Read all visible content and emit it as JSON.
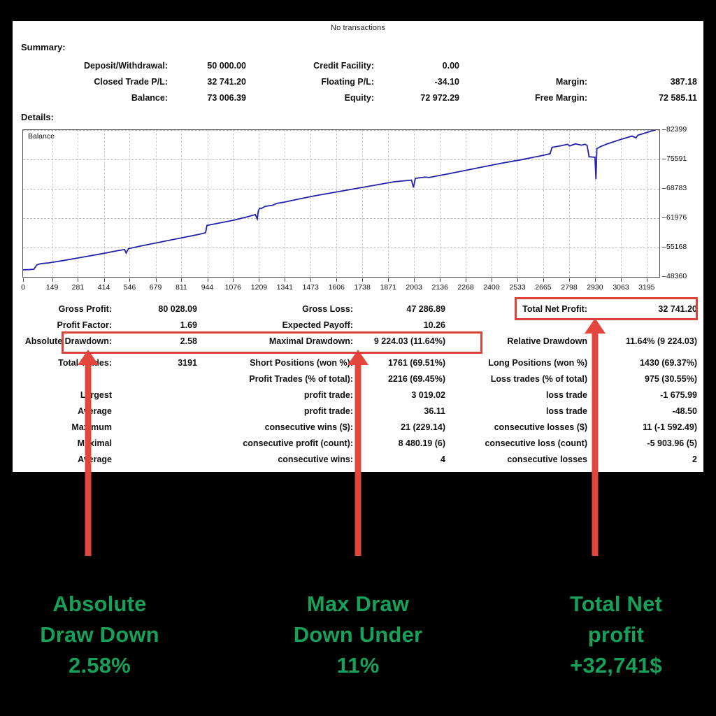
{
  "report": {
    "no_transactions": "No transactions",
    "summary_label": "Summary:",
    "details_label": "Details:",
    "summary_rows": [
      {
        "c1_label": "Deposit/Withdrawal:",
        "c1_value": "50 000.00",
        "c2_label": "Credit Facility:",
        "c2_value": "0.00",
        "c3_label": "",
        "c3_value": ""
      },
      {
        "c1_label": "Closed Trade P/L:",
        "c1_value": "32 741.20",
        "c2_label": "Floating P/L:",
        "c2_value": "-34.10",
        "c3_label": "Margin:",
        "c3_value": "387.18"
      },
      {
        "c1_label": "Balance:",
        "c1_value": "73 006.39",
        "c2_label": "Equity:",
        "c2_value": "72 972.29",
        "c3_label": "Free Margin:",
        "c3_value": "72 585.11"
      }
    ],
    "details_rows": [
      {
        "c1_label": "Gross Profit:",
        "c1_value": "80 028.09",
        "c2_label": "Gross Loss:",
        "c2_value": "47 286.89",
        "c3_label": "Total Net Profit:",
        "c3_value": "32 741.20"
      },
      {
        "c1_label": "Profit Factor:",
        "c1_value": "1.69",
        "c2_label": "Expected Payoff:",
        "c2_value": "10.26",
        "c3_label": "",
        "c3_value": ""
      },
      {
        "c1_label": "Absolute Drawdown:",
        "c1_value": "2.58",
        "c2_label": "Maximal Drawdown:",
        "c2_value": "9 224.03 (11.64%)",
        "c3_label": "Relative Drawdown",
        "c3_value": "11.64% (9 224.03)"
      },
      {
        "c1_label": "Total Trades:",
        "c1_value": "3191",
        "c2_label": "Short Positions (won %):",
        "c2_value": "1761 (69.51%)",
        "c3_label": "Long Positions (won %)",
        "c3_value": "1430 (69.37%)"
      },
      {
        "c1_label": "",
        "c1_value": "",
        "c2_label": "Profit Trades (% of total):",
        "c2_value": "2216 (69.45%)",
        "c3_label": "Loss trades (% of total)",
        "c3_value": "975 (30.55%)"
      },
      {
        "c1_label": "Largest",
        "c1_value": "",
        "c2_label": "profit trade:",
        "c2_value": "3 019.02",
        "c3_label": "loss trade",
        "c3_value": "-1 675.99"
      },
      {
        "c1_label": "Average",
        "c1_value": "",
        "c2_label": "profit trade:",
        "c2_value": "36.11",
        "c3_label": "loss trade",
        "c3_value": "-48.50"
      },
      {
        "c1_label": "Maximum",
        "c1_value": "",
        "c2_label": "consecutive wins ($):",
        "c2_value": "21 (229.14)",
        "c3_label": "consecutive losses ($)",
        "c3_value": "11 (-1 592.49)"
      },
      {
        "c1_label": "Maximal",
        "c1_value": "",
        "c2_label": "consecutive profit (count):",
        "c2_value": "8 480.19 (6)",
        "c3_label": "consecutive loss (count)",
        "c3_value": "-5 903.96 (5)"
      },
      {
        "c1_label": "Average",
        "c1_value": "",
        "c2_label": "consecutive wins:",
        "c2_value": "4",
        "c3_label": "consecutive losses",
        "c3_value": "2"
      }
    ]
  },
  "annotations": {
    "highlight_color": "#d9443a",
    "arrow_color": "#e2463c",
    "caption_color": "#17a05a",
    "items": [
      {
        "title_line1": "Absolute",
        "title_line2": "Draw Down",
        "value": "2.58%"
      },
      {
        "title_line1": "Max Draw",
        "title_line2": "Down Under",
        "value": "11%"
      },
      {
        "title_line1": "Total Net",
        "title_line2": "profit",
        "value": "+32,741$"
      }
    ]
  },
  "chart_data": {
    "type": "line",
    "title": "",
    "legend": "Balance",
    "legend_position": "top-left",
    "series_color": "#2222aa",
    "xlabel": "",
    "ylabel": "",
    "grid": true,
    "xlim": [
      0,
      3260
    ],
    "ylim": [
      48360,
      82399
    ],
    "xticks": [
      0,
      149,
      281,
      414,
      546,
      679,
      811,
      944,
      1076,
      1209,
      1341,
      1473,
      1606,
      1738,
      1871,
      2003,
      2136,
      2268,
      2400,
      2533,
      2665,
      2798,
      2930,
      3063,
      3195
    ],
    "yticks": [
      48360,
      55168,
      61976,
      68783,
      75591,
      82399
    ],
    "series": [
      {
        "name": "Balance",
        "x": [
          0,
          30,
          55,
          70,
          80,
          95,
          130,
          200,
          300,
          400,
          480,
          520,
          528,
          540,
          600,
          700,
          800,
          900,
          935,
          942,
          1000,
          1080,
          1150,
          1190,
          1200,
          1205,
          1212,
          1220,
          1240,
          1280,
          1300,
          1340,
          1400,
          1500,
          1600,
          1700,
          1800,
          1900,
          1990,
          2000,
          2010,
          2060,
          2080,
          2150,
          2250,
          2350,
          2450,
          2550,
          2650,
          2700,
          2710,
          2760,
          2790,
          2800,
          2830,
          2860,
          2880,
          2890,
          2900,
          2930,
          2935,
          2940,
          2960,
          3000,
          3060,
          3120,
          3140,
          3150,
          3200,
          3250
        ],
        "y": [
          50000,
          50050,
          50120,
          51100,
          51300,
          51450,
          51600,
          52100,
          52900,
          53700,
          54400,
          54700,
          53900,
          54900,
          55500,
          56400,
          57300,
          58200,
          58600,
          60300,
          60800,
          61500,
          62300,
          62800,
          61800,
          63600,
          64300,
          64200,
          64700,
          65000,
          65400,
          65700,
          66300,
          67200,
          68000,
          68800,
          69600,
          70400,
          70800,
          69100,
          71200,
          71500,
          71400,
          72000,
          72900,
          73800,
          74700,
          75500,
          76400,
          76900,
          78400,
          78800,
          79100,
          78700,
          79200,
          78900,
          79100,
          78800,
          76200,
          76100,
          71000,
          78100,
          78600,
          79300,
          80200,
          81000,
          80600,
          81200,
          81900,
          82600
        ]
      }
    ]
  }
}
